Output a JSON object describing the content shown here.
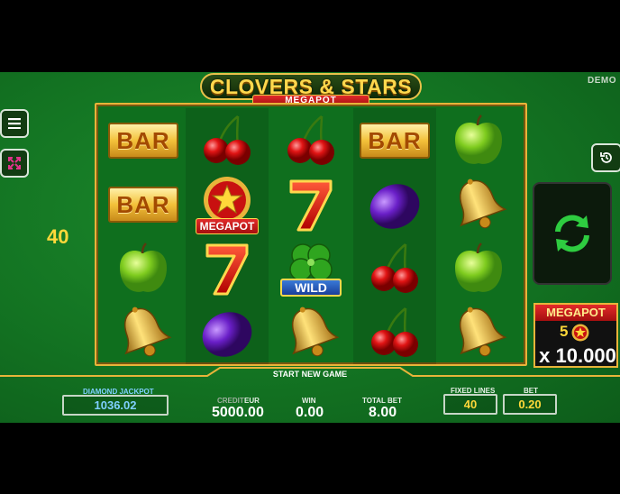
{
  "game": {
    "demo_label": "DEMO",
    "logo_title": "CLOVERS & STARS",
    "logo_subtitle": "MEGAPOT",
    "lines_indicator": "40",
    "megapot_badge": "MEGAPOT",
    "wild_label": "WILD",
    "bar_label": "BAR"
  },
  "megapot_panel": {
    "title": "MEGAPOT",
    "count": "5",
    "multiplier": "x 10.000"
  },
  "footer": {
    "start_text": "START NEW GAME",
    "jackpot_label": "DIAMOND JACKPOT",
    "jackpot_value": "1036.02",
    "credit_label": "CREDIT",
    "credit_currency": "EUR",
    "credit_value": "5000.00",
    "win_label": "WIN",
    "win_value": "0.00",
    "total_bet_label": "TOTAL BET",
    "total_bet_value": "8.00",
    "fixed_lines_label": "FIXED LINES",
    "fixed_lines_value": "40",
    "bet_label": "BET",
    "bet_value": "0.20"
  },
  "reels": [
    [
      "bar",
      "bar",
      "apple",
      "bell"
    ],
    [
      "cherry",
      "star-megapot",
      "seven",
      "plum"
    ],
    [
      "cherry",
      "seven",
      "clover-wild",
      "bell"
    ],
    [
      "bar",
      "plum",
      "cherry",
      "cherry"
    ],
    [
      "apple",
      "bell",
      "apple",
      "bell"
    ]
  ],
  "icons": {
    "menu": "menu-icon",
    "fullscreen": "fullscreen-icon",
    "history": "history-icon",
    "spin": "spin-icon"
  },
  "colors": {
    "background": "#137322",
    "gold": "#e8b43a",
    "jackpot_text": "#7fd0ff",
    "value_yellow": "#ffd83a"
  }
}
